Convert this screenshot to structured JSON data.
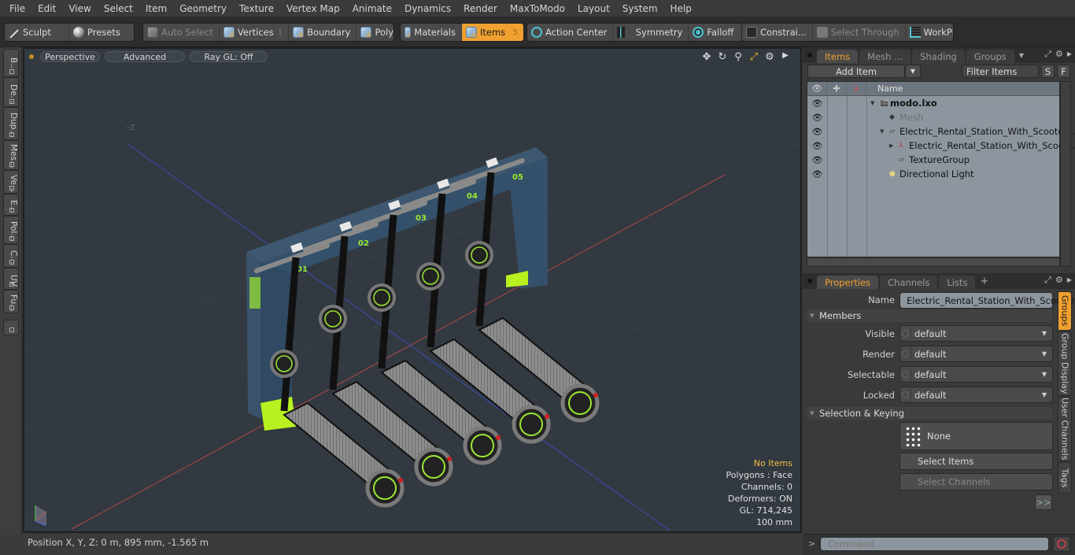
{
  "menubar": {
    "items": [
      "File",
      "Edit",
      "View",
      "Select",
      "Item",
      "Geometry",
      "Texture",
      "Vertex Map",
      "Animate",
      "Dynamics",
      "Render",
      "MaxToModo",
      "Layout",
      "System",
      "Help"
    ]
  },
  "toolbar": {
    "sculpt": "Sculpt",
    "presets": "Presets",
    "auto_select": "Auto Select",
    "vertices": "Vertices",
    "vertices_count": "1",
    "boundary": "Boundary",
    "polygons": "Polygons",
    "materials": "Materials",
    "items": "Items",
    "items_count": "5",
    "action_center": "Action Center",
    "symmetry": "Symmetry",
    "falloff": "Falloff",
    "constraints": "Constrai...",
    "select_through": "Select Through",
    "workplane": "WorkPlane",
    "accent_color": "#f0a030"
  },
  "left_strip": {
    "tabs": [
      "B...",
      "De...",
      "Dup...",
      "Mes...",
      "Ve...",
      "E...",
      "Pol...",
      "C...",
      "UV",
      "Fu..."
    ]
  },
  "viewport": {
    "view_mode": "Perspective",
    "shading": "Advanced",
    "raygl": "Ray GL: Off",
    "axis_label_neg_z": "-Z",
    "stats": {
      "selection": "No Items",
      "polygons": "Polygons : Face",
      "channels": "Channels: 0",
      "deformers": "Deformers: ON",
      "gl": "GL: 714,245",
      "grid": "100 mm"
    },
    "scene": {
      "dock_labels": [
        "01",
        "02",
        "03",
        "04",
        "05"
      ],
      "scooter_count": 5
    }
  },
  "statusbar": {
    "position": "Position X, Y, Z:   0 m, 895 mm, -1.565 m"
  },
  "items_panel": {
    "tabs": [
      "Items",
      "Mesh ...",
      "Shading",
      "Groups"
    ],
    "active_tab": "Items",
    "add_item": "Add Item",
    "filter_placeholder": "Filter Items",
    "s_btn": "S",
    "f_btn": "F",
    "column_name": "Name",
    "tree": [
      {
        "label": "modo.lxo",
        "indent": 0,
        "bold": true,
        "icon": "scene-icon"
      },
      {
        "label": "Mesh",
        "indent": 1,
        "dim": true,
        "icon": "mesh-icon"
      },
      {
        "label": "Electric_Rental_Station_With_Scoote ...",
        "indent": 1,
        "icon": "group-folder-icon"
      },
      {
        "label": "Electric_Rental_Station_With_Scoo ...",
        "indent": 2,
        "icon": "locator-icon"
      },
      {
        "label": "TextureGroup",
        "indent": 2,
        "icon": "group-folder-icon"
      },
      {
        "label": "Directional Light",
        "indent": 1,
        "icon": "light-icon"
      }
    ]
  },
  "properties_panel": {
    "tabs": [
      "Properties",
      "Channels",
      "Lists"
    ],
    "active_tab": "Properties",
    "add_tab": "+",
    "name_label": "Name",
    "name_value": "Electric_Rental_Station_With_Scooter",
    "members_section": "Members",
    "fields": [
      {
        "label": "Visible",
        "value": "default"
      },
      {
        "label": "Render",
        "value": "default"
      },
      {
        "label": "Selectable",
        "value": "default"
      },
      {
        "label": "Locked",
        "value": "default"
      }
    ],
    "selection_section": "Selection & Keying",
    "none_btn": "None",
    "select_items": "Select Items",
    "select_channels": "Select Channels",
    "more_btn": ">>",
    "side_tabs": [
      "Groups",
      "Group Display",
      "User Channels",
      "Tags"
    ],
    "active_side_tab": "Groups"
  },
  "command": {
    "prompt": ">",
    "placeholder": "Command"
  }
}
